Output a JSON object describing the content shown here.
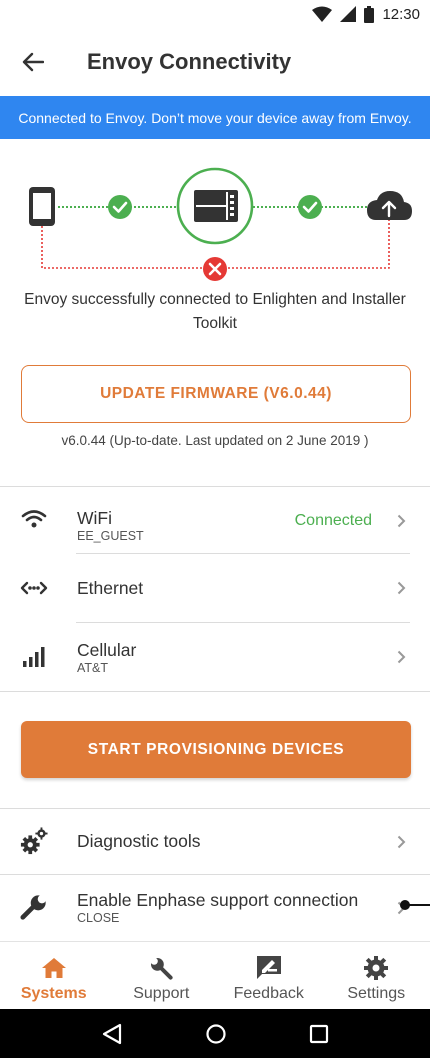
{
  "status_bar": {
    "time": "12:30"
  },
  "header": {
    "title": "Envoy Connectivity",
    "back_icon": "arrow-left-icon"
  },
  "banner": {
    "text": "Connected to Envoy. Don’t move your device away from Envoy."
  },
  "diagram": {
    "success_color": "#4caf50",
    "error_color": "#e53935"
  },
  "connection_message": "Envoy successfully connected to Enlighten and Installer Toolkit",
  "firmware": {
    "button_label": "UPDATE FIRMWARE (V6.0.44)",
    "status": "v6.0.44 (Up-to-date. Last updated on 2 June 2019 )"
  },
  "network": {
    "wifi": {
      "label": "WiFi",
      "sub": "EE_GUEST",
      "status": "Connected"
    },
    "ethernet": {
      "label": "Ethernet"
    },
    "cellular": {
      "label": "Cellular",
      "sub": "AT&T"
    }
  },
  "provisioning": {
    "button_label": "START PROVISIONING DEVICES"
  },
  "tools": {
    "diagnostic": {
      "label": "Diagnostic tools"
    },
    "support": {
      "label": "Enable Enphase support connection",
      "sub": "CLOSE"
    }
  },
  "bottom_nav": {
    "systems": "Systems",
    "support": "Support",
    "feedback": "Feedback",
    "settings": "Settings"
  },
  "colors": {
    "accent": "#e07b39",
    "banner": "#2f86f0",
    "connected": "#4caf50"
  }
}
